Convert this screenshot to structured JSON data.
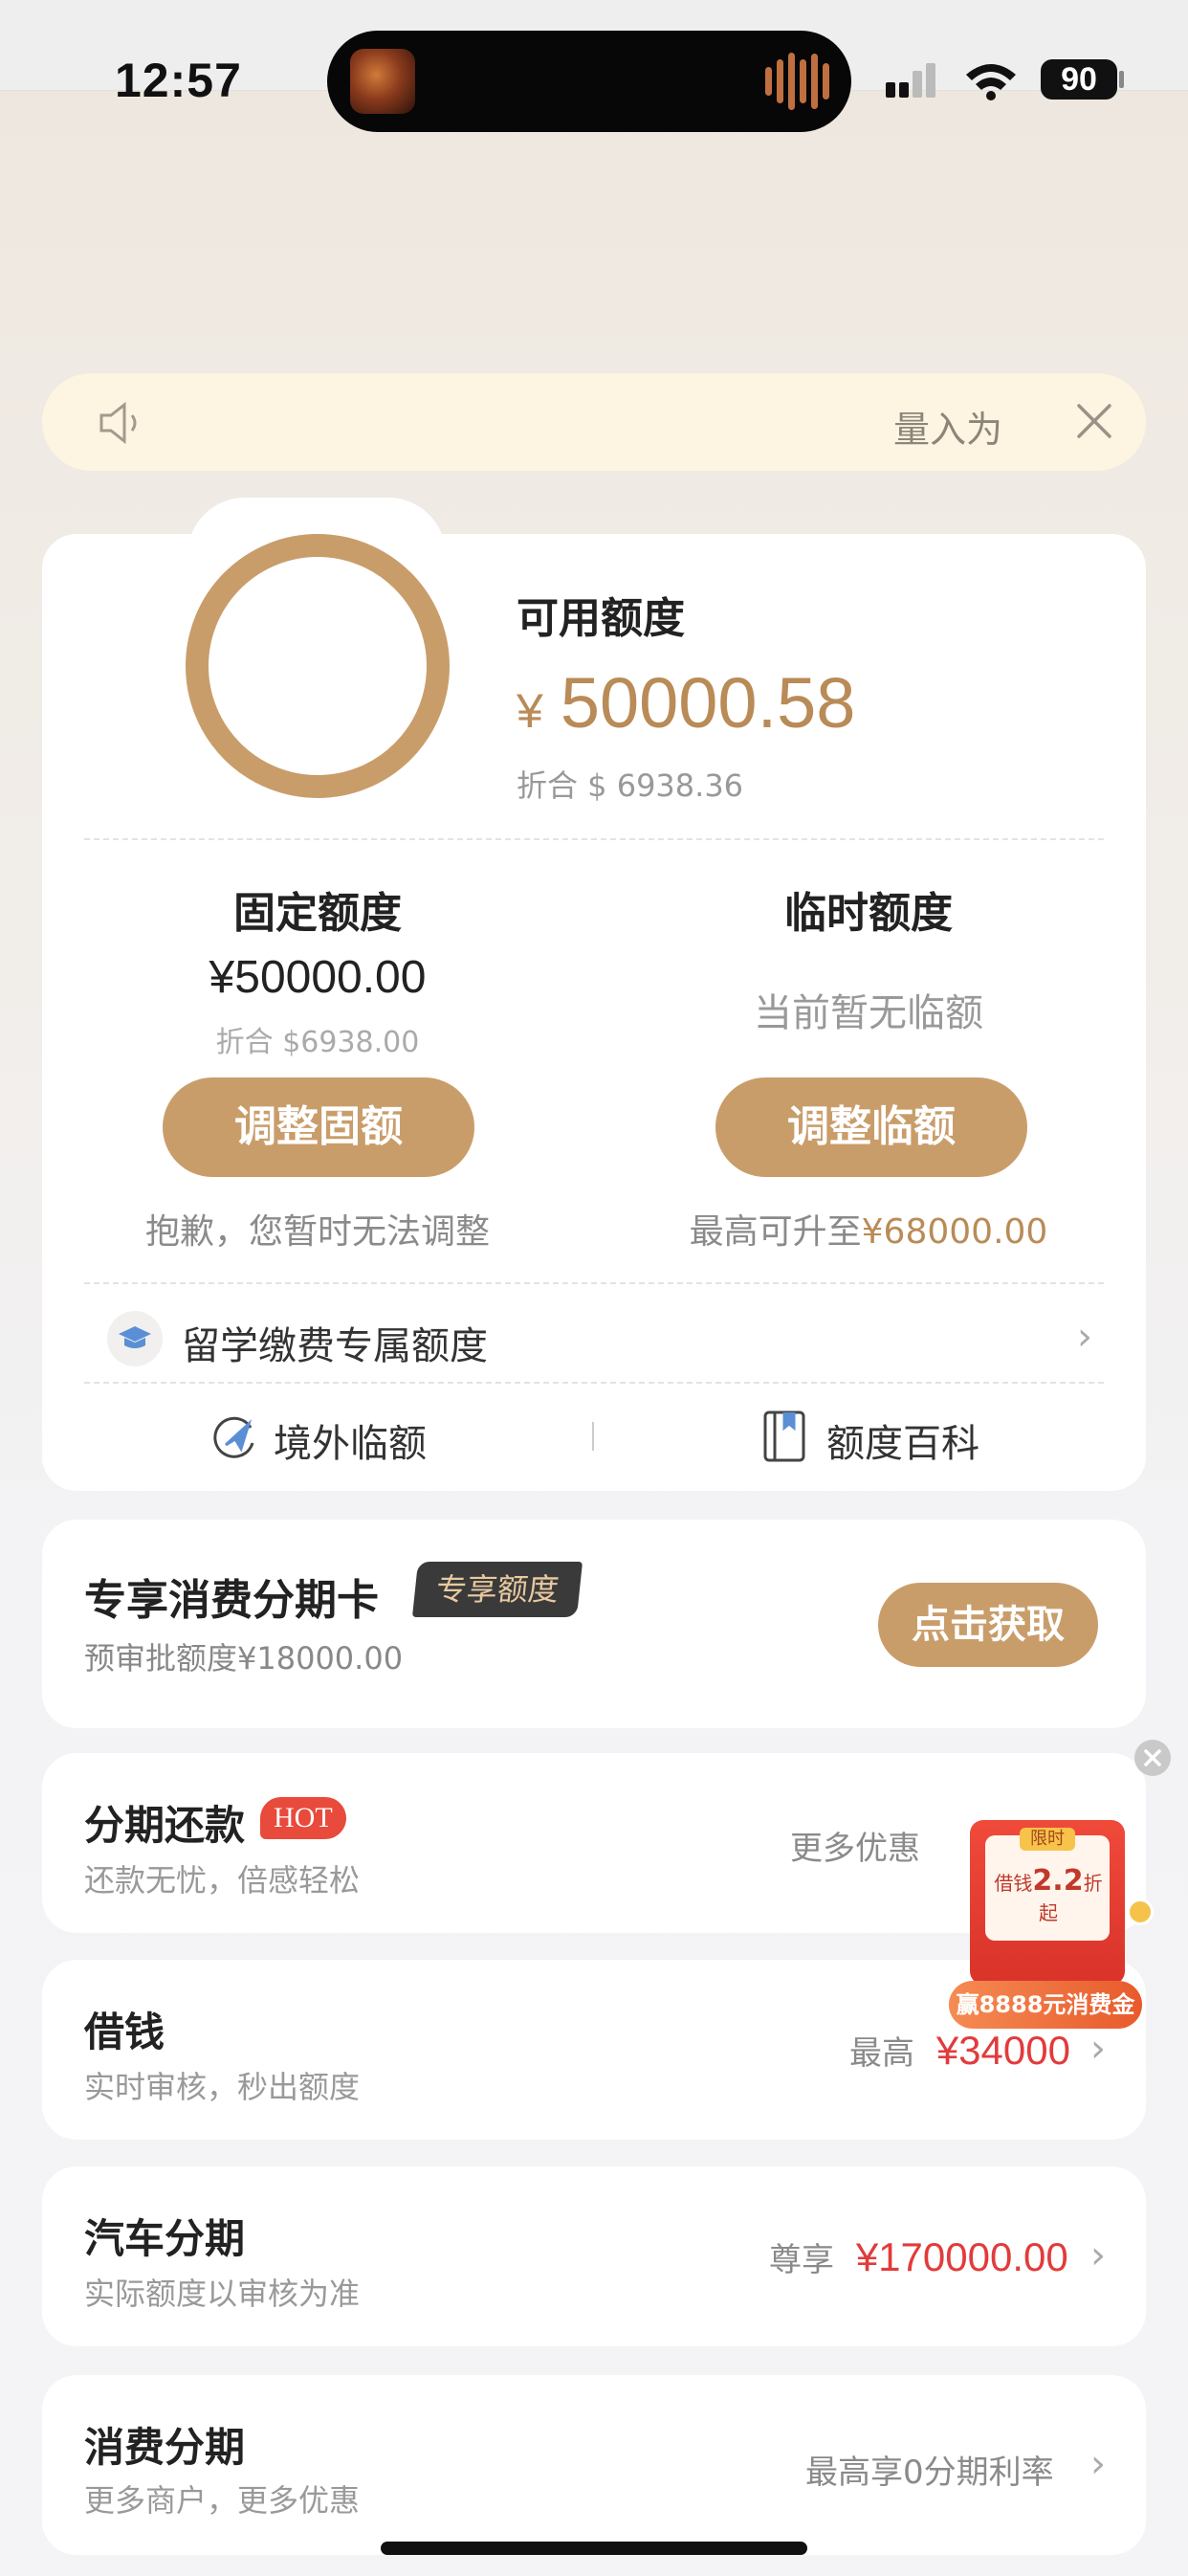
{
  "status_bar": {
    "time": "12:57",
    "battery": "90"
  },
  "notice": {
    "text": "量入为",
    "icons": [
      "speaker-icon",
      "close-icon"
    ]
  },
  "credit": {
    "available_label": "可用额度",
    "available_currency": "¥",
    "available_amount": "50000.58",
    "available_converted": "折合 $ 6938.36",
    "fixed": {
      "title": "固定额度",
      "amount": "¥50000.00",
      "converted": "折合 $6938.00",
      "button": "调整固额",
      "note": "抱歉，您暂时无法调整"
    },
    "temporary": {
      "title": "临时额度",
      "status": "当前暂无临额",
      "button": "调整临额",
      "note_prefix": "最高可升至",
      "note_amount": "¥68000.00"
    },
    "study_abroad": "留学缴费专属额度",
    "links": [
      {
        "label": "境外临额",
        "icon": "plane-icon"
      },
      {
        "label": "额度百科",
        "icon": "book-icon"
      }
    ]
  },
  "exclusive": {
    "title": "专享消费分期卡",
    "badge": "专享额度",
    "sub": "预审批额度¥18000.00",
    "button": "点击获取"
  },
  "rows": [
    {
      "title": "分期还款",
      "badge": "HOT",
      "sub": "还款无忧，倍感轻松",
      "right_label": "更多优惠",
      "right_value": ""
    },
    {
      "title": "借钱",
      "sub": "实时审核，秒出额度",
      "right_label": "最高",
      "right_value": "¥34000"
    },
    {
      "title": "汽车分期",
      "sub": "实际额度以审核为准",
      "right_label": "尊享",
      "right_value": "¥170000.00"
    },
    {
      "title": "消费分期",
      "sub": "更多商户，更多优惠",
      "right_label": "最高享0分期利率",
      "right_value": ""
    }
  ],
  "promo": {
    "tag": "限时",
    "line_prefix": "借钱",
    "line_value": "2.2",
    "line_suffix": "折起",
    "banner": "赢8888元消费金"
  },
  "colors": {
    "accent_gold": "#c99d6a",
    "amount_gold": "#b98b57",
    "red": "#e23b3b",
    "notice_bg": "#fdf4e2"
  }
}
